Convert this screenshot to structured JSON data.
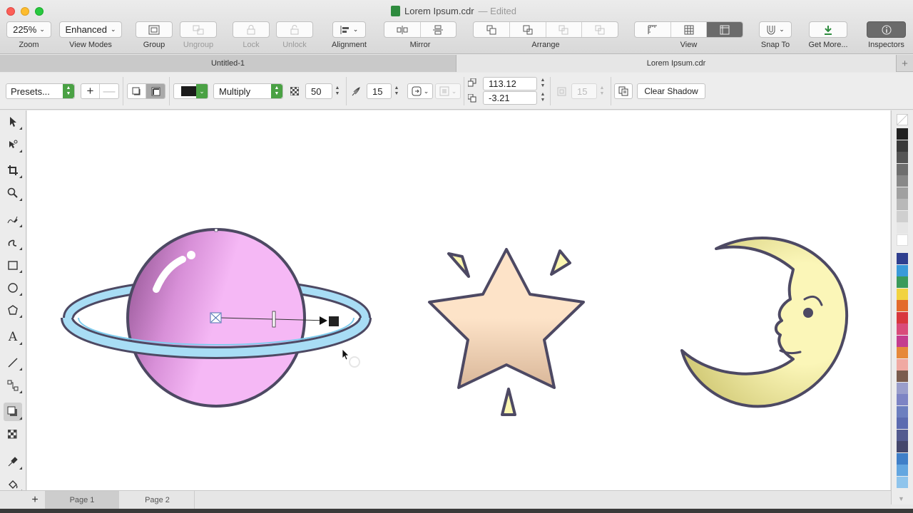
{
  "window": {
    "title": "Lorem Ipsum.cdr",
    "status": "— Edited"
  },
  "toolbar": {
    "zoom_value": "225%",
    "zoom_label": "Zoom",
    "view_mode_value": "Enhanced",
    "view_mode_label": "View Modes",
    "group_label": "Group",
    "ungroup_label": "Ungroup",
    "lock_label": "Lock",
    "unlock_label": "Unlock",
    "alignment_label": "Alignment",
    "mirror_label": "Mirror",
    "arrange_label": "Arrange",
    "view_label": "View",
    "snap_label": "Snap To",
    "getmore_label": "Get More...",
    "inspectors_label": "Inspectors"
  },
  "tabs": [
    {
      "label": "Untitled-1"
    },
    {
      "label": "Lorem Ipsum.cdr"
    }
  ],
  "propbar": {
    "presets": "Presets...",
    "blend_mode": "Multiply",
    "opacity": "50",
    "feather": "15",
    "offset_x": "113.12",
    "offset_y": "-3.21",
    "disabled_value": "15",
    "clear_shadow": "Clear Shadow",
    "shadow_color": "#1b1b1b"
  },
  "pages": [
    {
      "label": "Page 1"
    },
    {
      "label": "Page 2"
    }
  ],
  "palette": [
    "#222222",
    "#3a3a3a",
    "#555555",
    "#6e6e6e",
    "#888888",
    "#a0a0a0",
    "#b8b8b8",
    "#cfcfcf",
    "#e6e6e6",
    "#ffffff",
    "#2f3f8f",
    "#3a9ad9",
    "#3b9a5a",
    "#f2d340",
    "#e36b2c",
    "#d8373d",
    "#d94b7a",
    "#c43d8f",
    "#e6893a",
    "#f0a9a2",
    "#7a5c4e",
    "#9a9ecb",
    "#7d84c4",
    "#6c7fbf",
    "#5b6bb0",
    "#525a8f",
    "#44476c",
    "#3f7fc8",
    "#63a6e0",
    "#8fc4ec"
  ],
  "colors": {
    "planet": "#f5b8f5",
    "ring": "#a8ddf5",
    "star": "#fde3c8",
    "moon": "#fbf6b0",
    "outline": "#4d4963",
    "spark": "#fbf6b0"
  }
}
